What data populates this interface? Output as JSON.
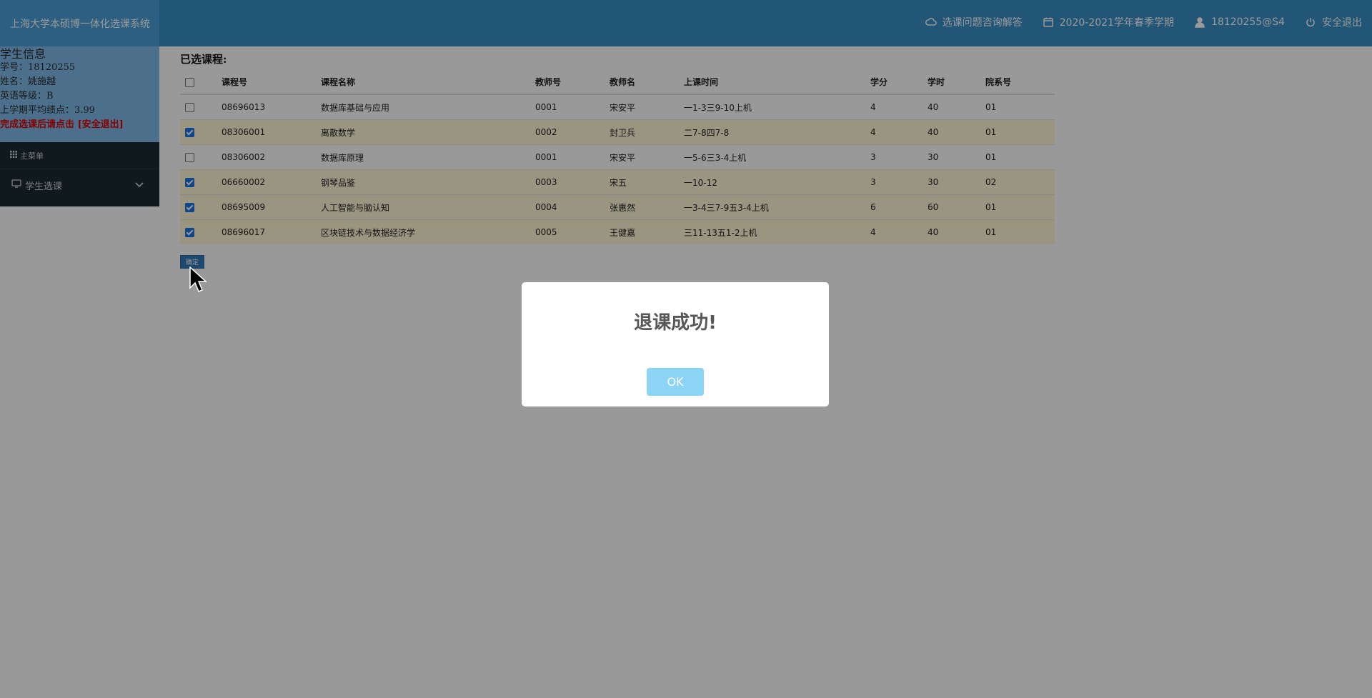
{
  "header": {
    "brand": "上海大学本硕博一体化选课系统",
    "nav": [
      {
        "icon": "cloud-icon",
        "label": "选课问题咨询解答"
      },
      {
        "icon": "calendar-icon",
        "label": "2020-2021学年春季学期"
      },
      {
        "icon": "user-icon",
        "label": "18120255@S4"
      },
      {
        "icon": "power-icon",
        "label": "安全退出"
      }
    ]
  },
  "student": {
    "title": "学生信息",
    "id_line": "学号：18120255",
    "name_line": "姓名：姚施越",
    "english_line": "英语等级：B",
    "gpa_line": "上学期平均绩点：3.99",
    "warning": "完成选课后请点击 [安全退出]"
  },
  "menu": {
    "title": "主菜单",
    "item": "学生选课"
  },
  "main": {
    "heading": "已选课程:",
    "columns": [
      "课程号",
      "课程名称",
      "教师号",
      "教师名",
      "上课时间",
      "学分",
      "学时",
      "院系号"
    ],
    "rows": [
      {
        "checked": false,
        "cells": [
          "08696013",
          "数据库基础与应用",
          "0001",
          "宋安平",
          "一1-3三9-10上机",
          "4",
          "40",
          "01"
        ]
      },
      {
        "checked": true,
        "cells": [
          "08306001",
          "离散数学",
          "0002",
          "封卫兵",
          "二7-8四7-8",
          "4",
          "40",
          "01"
        ]
      },
      {
        "checked": false,
        "cells": [
          "08306002",
          "数据库原理",
          "0001",
          "宋安平",
          "一5-6三3-4上机",
          "3",
          "30",
          "01"
        ]
      },
      {
        "checked": true,
        "cells": [
          "06660002",
          "钢琴品鉴",
          "0003",
          "宋五",
          "一10-12",
          "3",
          "30",
          "02"
        ]
      },
      {
        "checked": true,
        "cells": [
          "08695009",
          "人工智能与脑认知",
          "0004",
          "张惠然",
          "一3-4三7-9五3-4上机",
          "6",
          "60",
          "01"
        ]
      },
      {
        "checked": true,
        "cells": [
          "08696017",
          "区块链技术与数据经济学",
          "0005",
          "王健嘉",
          "三11-13五1-2上机",
          "4",
          "40",
          "01"
        ]
      }
    ],
    "confirm_label": "确定"
  },
  "dialog": {
    "message": "退课成功!",
    "ok_label": "OK"
  }
}
